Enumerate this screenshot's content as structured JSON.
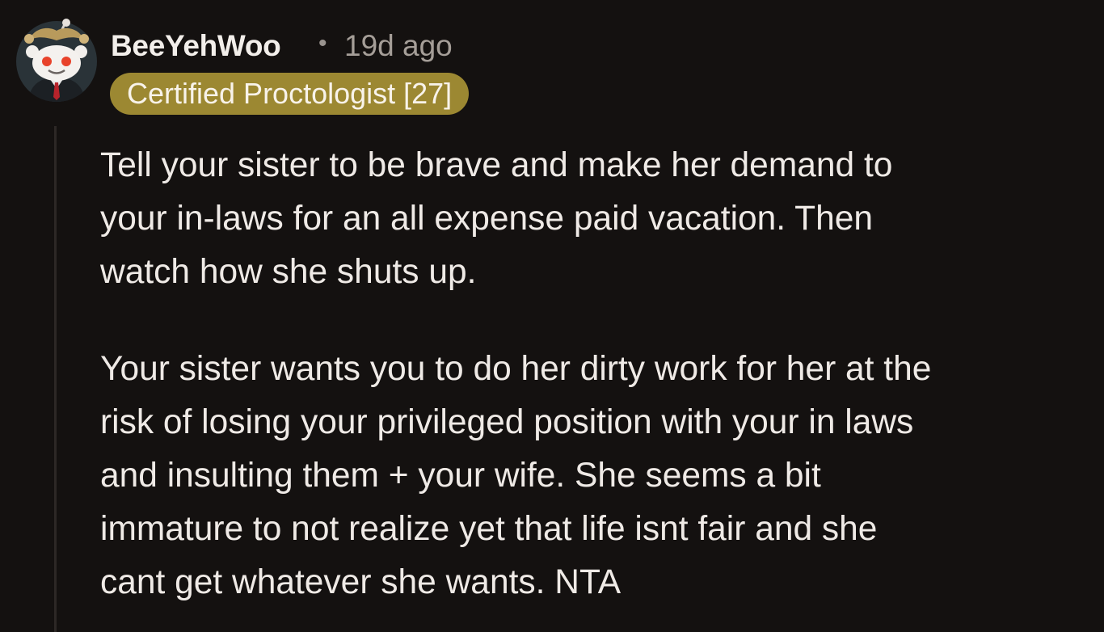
{
  "comment": {
    "author": "BeeYehWoo",
    "separator": "•",
    "age": "19d ago",
    "flair": "Certified Proctologist [27]",
    "avatar_icon": "snoo-avatar-icon",
    "paragraphs": [
      "Tell your sister to be brave and make her demand to\nyour in-laws for an all expense paid vacation. Then\nwatch how she shuts up.",
      "Your sister wants you to do her dirty work for her at the\nrisk of losing your privileged position with your in laws\nand insulting them + your wife. She seems a bit\nimmature to not realize yet that life isnt fair and she\ncant get whatever she wants. NTA"
    ]
  },
  "colors": {
    "background": "#141110",
    "flair_background": "#9c8832",
    "timestamp": "#a59e98",
    "thread_line": "#2d2826"
  }
}
